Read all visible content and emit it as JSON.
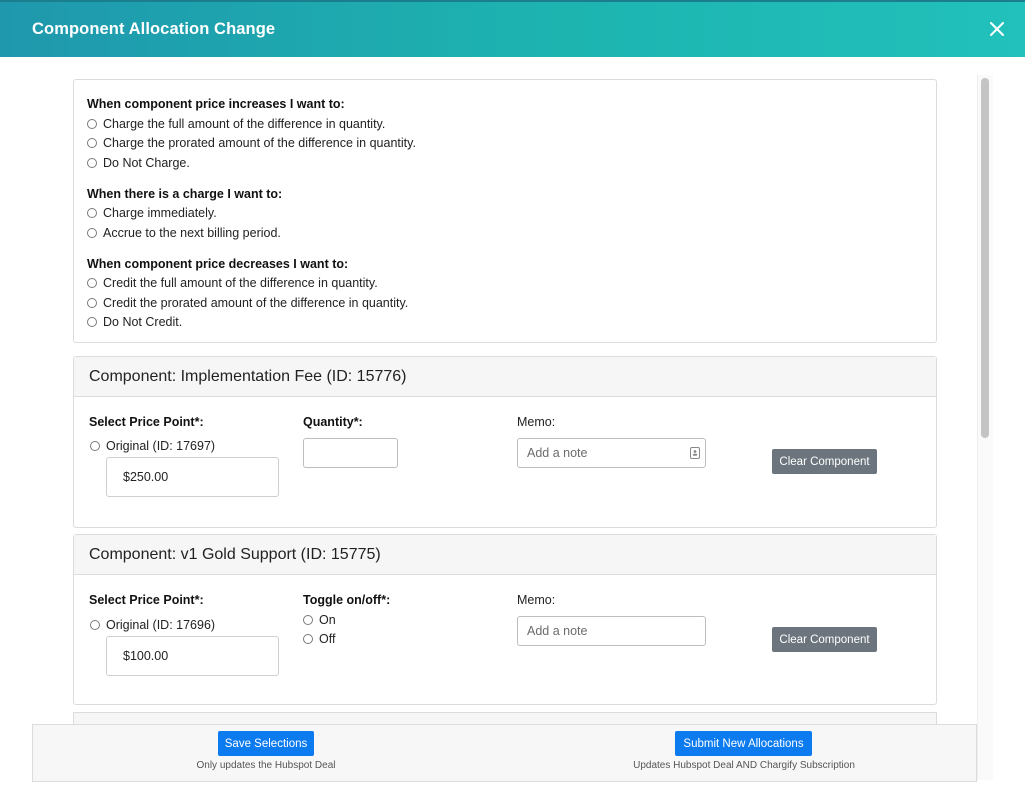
{
  "dialog": {
    "title": "Component Allocation Change"
  },
  "options": {
    "increase": {
      "title": "When component price increases I want to:",
      "items": [
        "Charge the full amount of the difference in quantity.",
        "Charge the prorated amount of the difference in quantity.",
        "Do Not Charge."
      ]
    },
    "charge": {
      "title": "When there is a charge I want to:",
      "items": [
        "Charge immediately.",
        "Accrue to the next billing period."
      ]
    },
    "decrease": {
      "title": "When component price decreases I want to:",
      "items": [
        "Credit the full amount of the difference in quantity.",
        "Credit the prorated amount of the difference in quantity.",
        "Do Not Credit."
      ]
    }
  },
  "components": [
    {
      "header": "Component: Implementation Fee (ID: 15776)",
      "price_label": "Select Price Point*:",
      "price_option": "Original (ID: 17697)",
      "price_value": "$250.00",
      "qty_label": "Quantity*:",
      "memo_label": "Memo:",
      "memo_placeholder": "Add a note",
      "clear_label": "Clear Component"
    },
    {
      "header": "Component: v1 Gold Support (ID: 15775)",
      "price_label": "Select Price Point*:",
      "price_option": "Original (ID: 17696)",
      "price_value": "$100.00",
      "toggle_label": "Toggle on/off*:",
      "toggle_on": "On",
      "toggle_off": "Off",
      "memo_label": "Memo:",
      "memo_placeholder": "Add a note",
      "clear_label": "Clear Component"
    }
  ],
  "footer": {
    "save_label": "Save Selections",
    "save_note": "Only updates the Hubspot Deal",
    "submit_label": "Submit New Allocations",
    "submit_note": "Updates Hubspot Deal AND Chargify Subscription"
  },
  "icons": {
    "close": "close-icon",
    "memo": "contact-card-icon"
  },
  "colors": {
    "header_start": "#1f98ad",
    "header_end": "#22c1bb",
    "primary": "#0d7bf0",
    "secondary": "#6c757d"
  }
}
